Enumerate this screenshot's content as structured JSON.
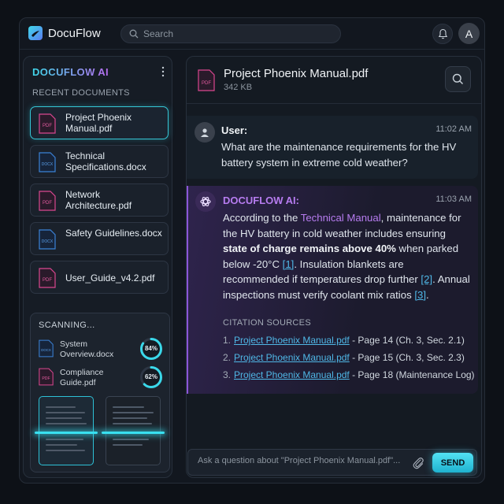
{
  "app": {
    "name": "DocuFlow"
  },
  "search": {
    "placeholder": "Search"
  },
  "user": {
    "avatar_initial": "A"
  },
  "sidebar": {
    "title": "DOCUFLOW AI",
    "section_label": "RECENT DOCUMENTS",
    "documents": [
      {
        "name": "Project Phoenix Manual.pdf",
        "type": "PDF",
        "active": true
      },
      {
        "name": "Technical Specifications.docx",
        "type": "DOCX",
        "active": false
      },
      {
        "name": "Network Architecture.pdf",
        "type": "PDF",
        "active": false
      },
      {
        "name": "Safety Guidelines.docx",
        "type": "DOCX",
        "active": false
      },
      {
        "name": "User_Guide_v4.2.pdf",
        "type": "PDF",
        "active": false
      }
    ],
    "scanning": {
      "title": "SCANNING...",
      "items": [
        {
          "name": "System Overview.docx",
          "type": "DOCX",
          "progress_label": "84%",
          "progress": 0.84
        },
        {
          "name": "Compliance Guide.pdf",
          "type": "PDF",
          "progress_label": "62%",
          "progress": 0.62
        }
      ]
    }
  },
  "main": {
    "file_title": "Project Phoenix Manual.pdf",
    "file_type": "PDF",
    "file_size": "342 KB",
    "messages": {
      "user": {
        "sender": "User:",
        "time": "11:02 AM",
        "text": "What are the maintenance requirements for the HV battery system in extreme cold weather?"
      },
      "ai": {
        "sender": "DOCUFLOW AI:",
        "time": "11:03 AM",
        "parts": {
          "p1": "According to the ",
          "source_link": "Technical Manual",
          "p2": ", maintenance for the HV battery in cold weather includes ensuring ",
          "bold": "state of charge remains above 40%",
          "p3": " when parked below -20°C ",
          "ref1": "[1]",
          "p4": ". Insulation blankets are recommended if temperatures drop further ",
          "ref2": "[2]",
          "p5": ". Annual inspections must verify coolant mix ratios ",
          "ref3": "[3]",
          "p6": "."
        },
        "citations_title": "CITATION SOURCES",
        "citations": [
          {
            "num": "1.",
            "link": "Project Phoenix Manual.pdf",
            "detail": " - Page 14 (Ch. 3, Sec. 2.1)"
          },
          {
            "num": "2.",
            "link": "Project Phoenix Manual.pdf",
            "detail": " - Page 15 (Ch. 3, Sec. 2.3)"
          },
          {
            "num": "3.",
            "link": "Project Phoenix Manual.pdf",
            "detail": " - Page 18 (Maintenance Log)"
          }
        ]
      }
    },
    "composer": {
      "placeholder": "Ask a question about \"Project Phoenix Manual.pdf\"...",
      "send_label": "SEND"
    }
  },
  "colors": {
    "accent_cyan": "#35c6d6",
    "accent_purple": "#8b56d8",
    "pdf_icon": "#d9478f",
    "docx_icon": "#3b82d6",
    "link": "#4fb7e6"
  },
  "icons": {
    "logo": "docuflow-logo-icon",
    "search": "search-icon",
    "bell": "bell-icon",
    "more": "more-vertical-icon",
    "user": "user-icon",
    "ai": "ai-icon",
    "attach": "paperclip-icon",
    "pdf": "pdf-file-icon",
    "docx": "docx-file-icon"
  }
}
